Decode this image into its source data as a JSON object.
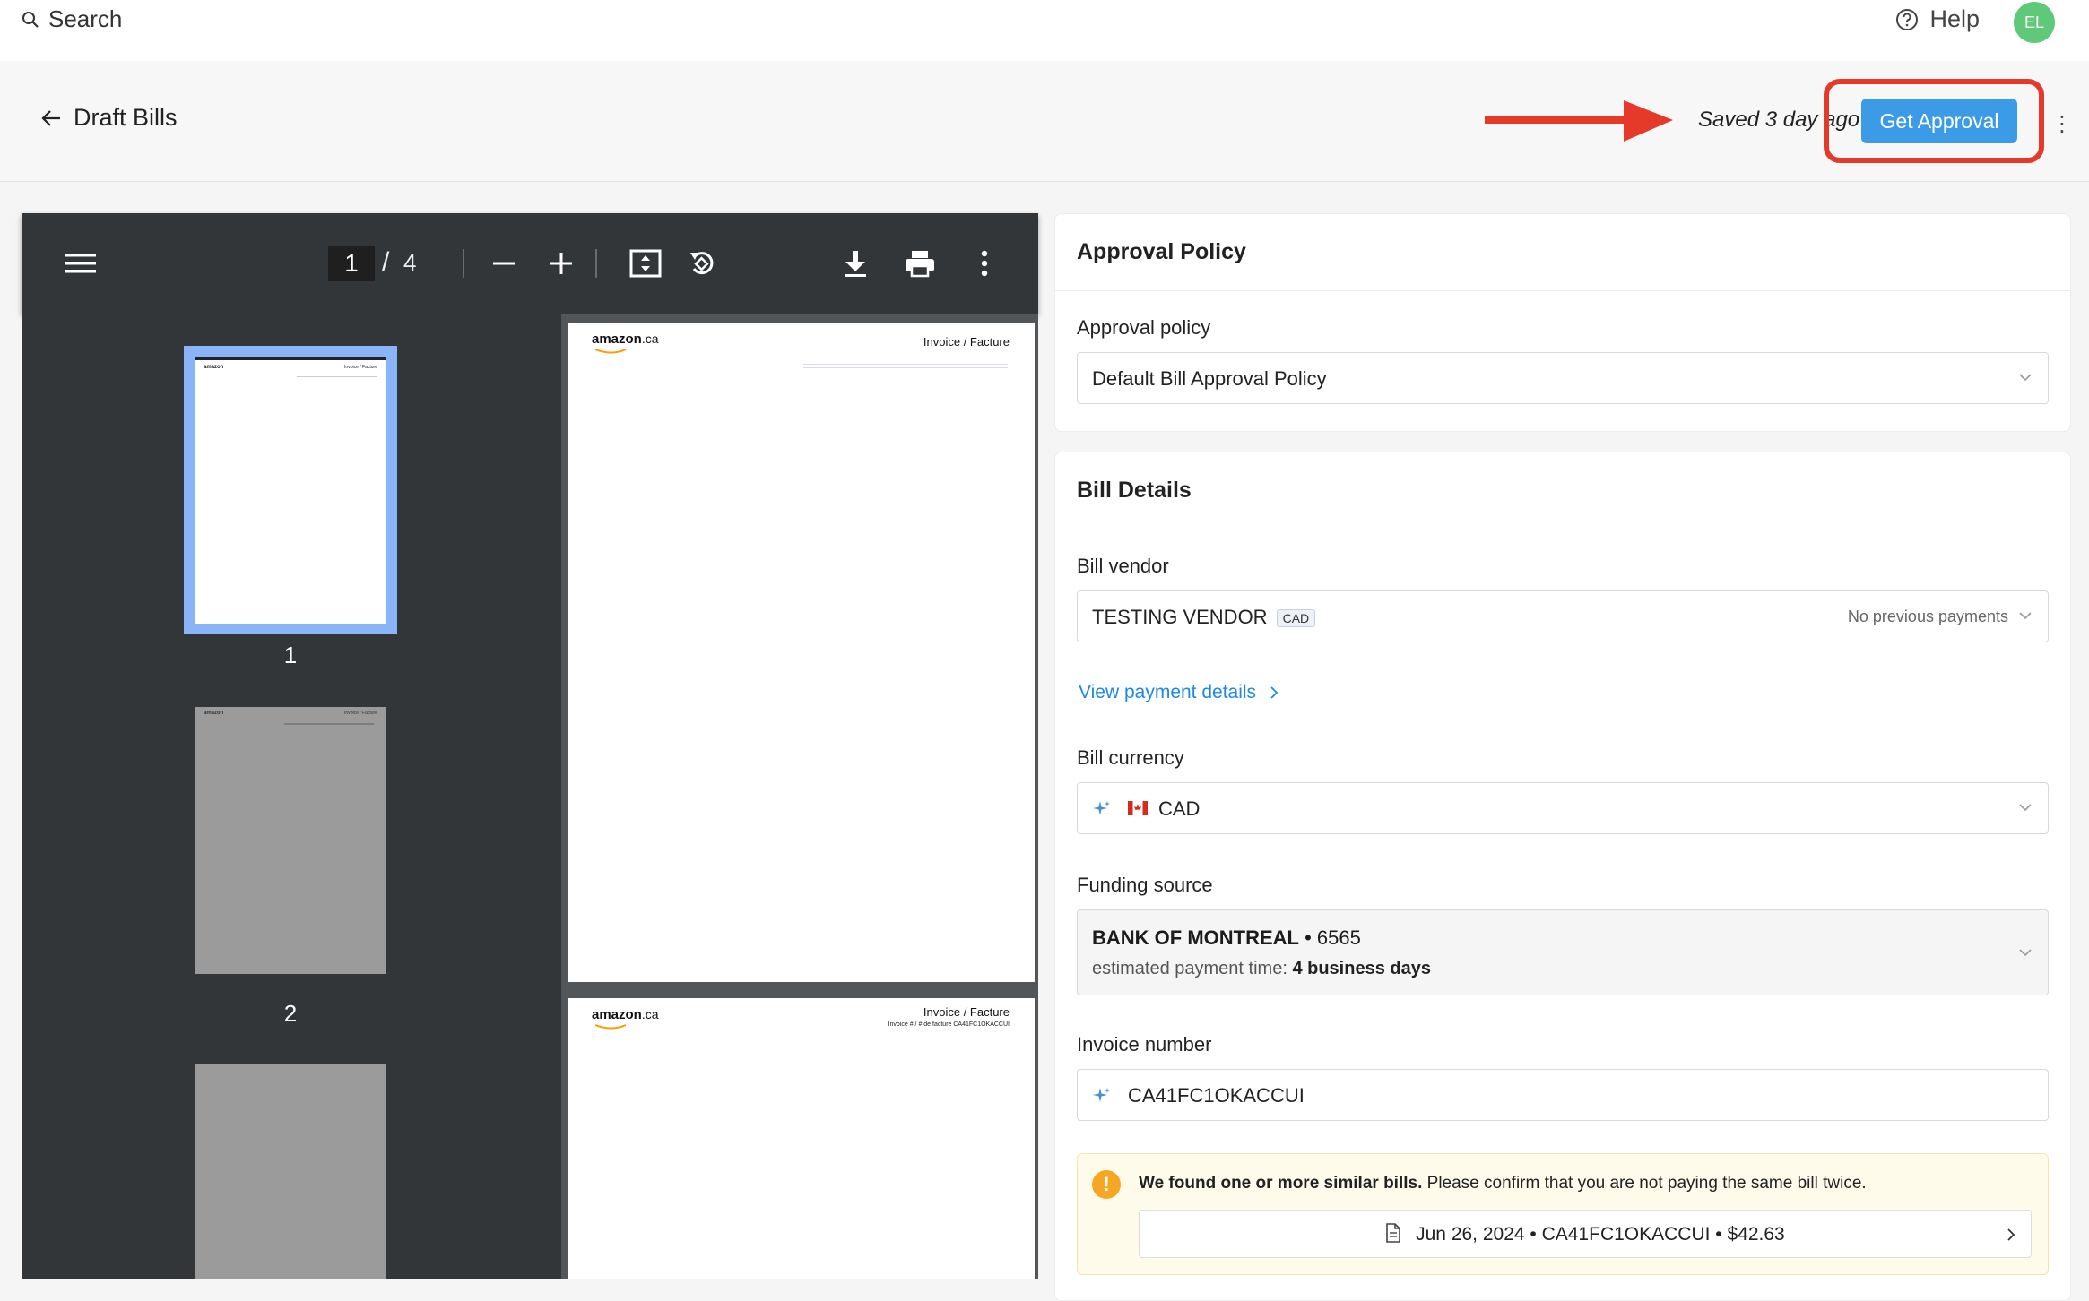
{
  "topbar": {
    "search_label": "Search",
    "help_label": "Help",
    "avatar_initials": "EL"
  },
  "header": {
    "back_label": "Draft Bills",
    "saved_status": "Saved 3 day ago",
    "primary_button": "Get Approval"
  },
  "pdf_viewer": {
    "current_page": "1",
    "page_separator": "/",
    "total_pages": "4",
    "thumbnails": [
      {
        "label": "1"
      },
      {
        "label": "2"
      }
    ],
    "page1": {
      "brand": "amazon",
      "brand_suffix": ".ca",
      "doc_title": "Invoice / Facture"
    },
    "page2": {
      "brand": "amazon",
      "brand_suffix": ".ca",
      "doc_title": "Invoice / Facture",
      "doc_subtitle": "Invoice # / # de facture CA41FC1OKACCUI"
    }
  },
  "approval_policy": {
    "title": "Approval Policy",
    "field_label": "Approval policy",
    "value": "Default Bill Approval Policy"
  },
  "bill_details": {
    "title": "Bill Details",
    "vendor_label": "Bill vendor",
    "vendor_value": "TESTING VENDOR",
    "vendor_currency_tag": "CAD",
    "vendor_hint": "No previous payments",
    "payment_link": "View payment details",
    "currency_label": "Bill currency",
    "currency_value": "CAD",
    "funding_label": "Funding source",
    "funding_bank": "BANK OF MONTREAL",
    "funding_account": "• 6565",
    "funding_time_label": "estimated payment time:",
    "funding_time_value": "4 business days",
    "invoice_label": "Invoice number",
    "invoice_value": "CA41FC1OKACCUI",
    "warning_bold": "We found one or more similar bills.",
    "warning_text": "Please confirm that you are not paying the same bill twice.",
    "similar_bill": "Jun 26, 2024 • CA41FC1OKACCUI • $42.63"
  },
  "colors": {
    "primary": "#3b9be6",
    "highlight": "#e53a2a",
    "link": "#1e88e5",
    "warning": "#f5a623",
    "avatar": "#5fc97a"
  }
}
